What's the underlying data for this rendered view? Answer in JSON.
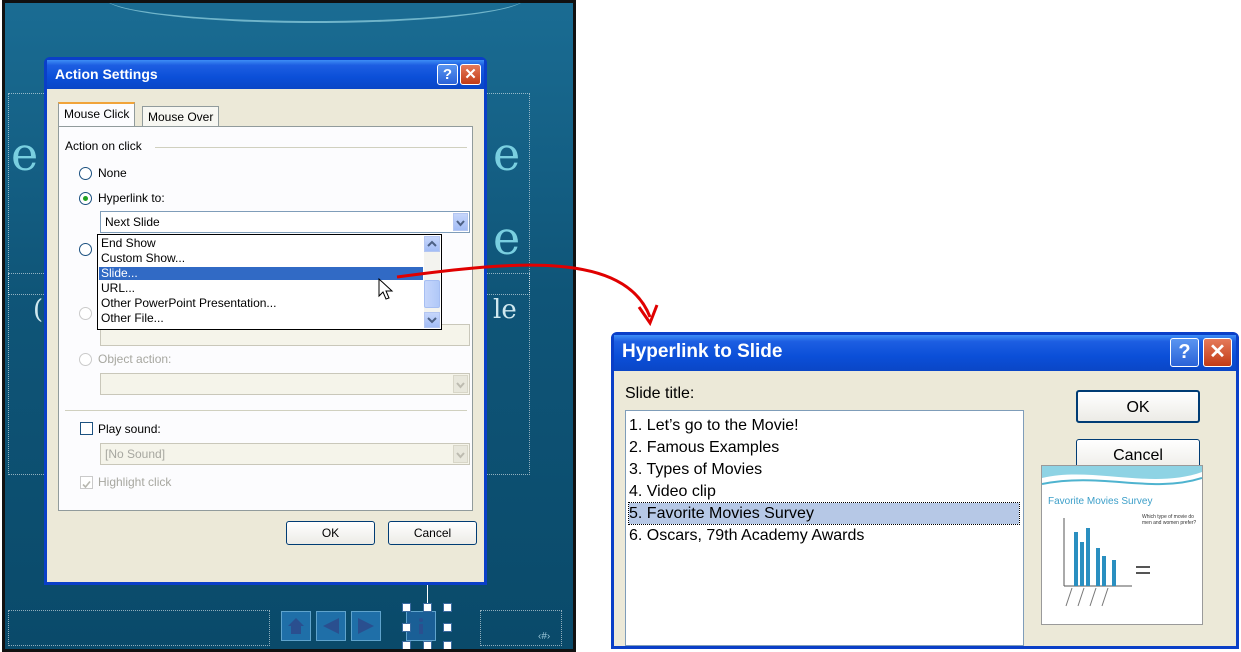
{
  "slide": {
    "bg_letters": [
      "e",
      "e",
      "e",
      "e"
    ],
    "bg_text_right": "le",
    "bg_text_left": "(",
    "page_placeholder": "‹#›"
  },
  "action_settings": {
    "title": "Action Settings",
    "help_glyph": "?",
    "close_glyph": "✕",
    "tabs": [
      "Mouse Click",
      "Mouse Over"
    ],
    "group_label": "Action on click",
    "options": {
      "none": "None",
      "hyperlink": "Hyperlink to:",
      "object_action": "Object action:"
    },
    "hyperlink_value": "Next Slide",
    "dropdown_items": [
      "End Show",
      "Custom Show...",
      "Slide...",
      "URL...",
      "Other PowerPoint Presentation...",
      "Other File..."
    ],
    "dropdown_selected_index": 2,
    "play_sound_label": "Play sound:",
    "sound_value": "[No Sound]",
    "highlight_label": "Highlight click",
    "ok_label": "OK",
    "cancel_label": "Cancel"
  },
  "hyperlink_to_slide": {
    "title": "Hyperlink to Slide",
    "help_glyph": "?",
    "close_glyph": "✕",
    "list_label": "Slide title:",
    "slides": [
      "1. Let’s go to the Movie!",
      "2. Famous Examples",
      "3. Types of Movies",
      "4. Video clip",
      "5. Favorite Movies Survey",
      "6. Oscars, 79th Academy Awards"
    ],
    "selected_index": 4,
    "ok_label": "OK",
    "cancel_label": "Cancel",
    "preview": {
      "title": "Favorite Movies Survey",
      "question": "Which type of movie do men and women prefer?"
    }
  },
  "colors": {
    "slide_bg": "#0f5578",
    "xp_title": "#0b4fd8",
    "dialog_face": "#ece9d8",
    "selection": "#316ac5",
    "connector_arrow": "#e00000"
  }
}
